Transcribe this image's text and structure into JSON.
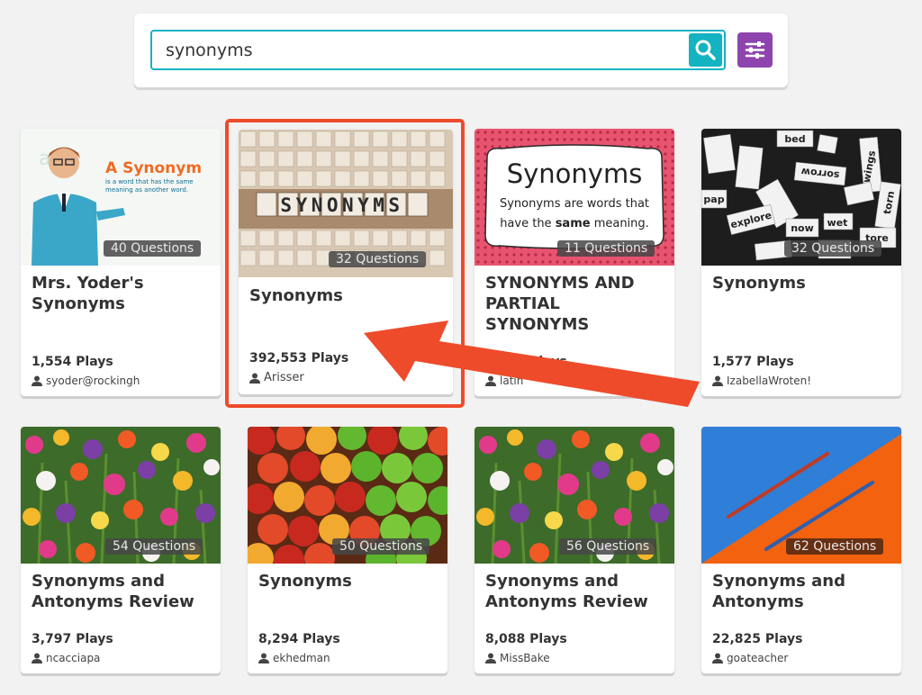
{
  "search": {
    "value": "synonyms"
  },
  "icons": {
    "search": "search-icon",
    "filter": "sliders-icon",
    "person": "person-icon"
  },
  "colors": {
    "accent": "#14b3c2",
    "filter": "#8e44ad",
    "highlight": "#ee4b2b"
  },
  "cards": [
    {
      "title": "Mrs. Yoder's Synonyms",
      "questions": "40 Questions",
      "plays": "1,554 Plays",
      "author": "syoder@rockingh",
      "thumb_heading": "A Synonym",
      "thumb_text": "is a word that has the same meaning as another word."
    },
    {
      "title": "Synonyms",
      "questions": "32 Questions",
      "plays": "392,553 Plays",
      "author": "Arisser",
      "thumb_heading": "SYNONYMS"
    },
    {
      "title": "SYNONYMS AND PARTIAL SYNONYMS",
      "questions": "11 Questions",
      "plays": "2,028 Plays",
      "author": "latin",
      "thumb_heading": "Synonyms",
      "thumb_line1": "Synonyms are words that",
      "thumb_line2_a": "have the ",
      "thumb_line2_b": "same",
      "thumb_line2_c": " meaning."
    },
    {
      "title": "Synonyms",
      "questions": "32 Questions",
      "plays": "1,577 Plays",
      "author": "IzabellaWroten!",
      "thumb_words": [
        "bed",
        "wings",
        "wet",
        "now",
        "torn",
        "sorrow",
        "explore",
        "pap",
        "tore"
      ]
    },
    {
      "title": "Synonyms and Antonyms Review",
      "questions": "54 Questions",
      "plays": "3,797 Plays",
      "author": "ncacciapa"
    },
    {
      "title": "Synonyms",
      "questions": "50 Questions",
      "plays": "8,294 Plays",
      "author": "ekhedman"
    },
    {
      "title": "Synonyms and Antonyms Review",
      "questions": "56 Questions",
      "plays": "8,088 Plays",
      "author": "MissBake"
    },
    {
      "title": "Synonyms and Antonyms",
      "questions": "62 Questions",
      "plays": "22,825 Plays",
      "author": "goateacher"
    }
  ]
}
